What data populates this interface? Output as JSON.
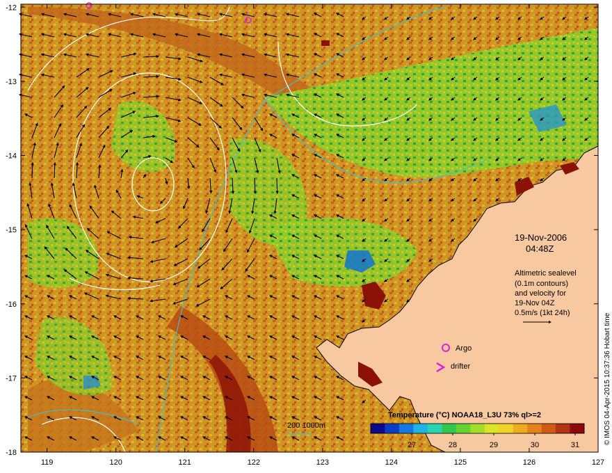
{
  "date_line": "19-Nov-2006",
  "time_line": "04:48Z",
  "info_lines": [
    "Altimetric sealevel",
    "(0.1m contours)",
    "and velocity for",
    "19-Nov 04Z",
    "0.5m/s (1kt 24h)"
  ],
  "legend_argo": "Argo",
  "legend_drifter": "drifter",
  "colorbar_title": "Temperature (°C) NOAA18_L3U 73% ql>=2",
  "colorbar_ticks": [
    "27",
    "28",
    "29",
    "30",
    "31"
  ],
  "bathymetry_label": "200  1000m",
  "credit": "© IMOS 04-Apr-2015 10:37:36 Hobart time",
  "x_ticks": [
    "119",
    "120",
    "121",
    "122",
    "123",
    "124",
    "125",
    "126",
    "127"
  ],
  "y_ticks": [
    "-12",
    "-13",
    "-14",
    "-15",
    "-16",
    "-17",
    "-18"
  ],
  "colors": {
    "land": "#f8c8a0",
    "sst_warm": "#c85a14",
    "sst_mid": "#d7a020",
    "sst_cool": "#6ccc24",
    "contour": "#ffffff",
    "isobath": "#40c0c8",
    "argo": "#e020e0"
  }
}
